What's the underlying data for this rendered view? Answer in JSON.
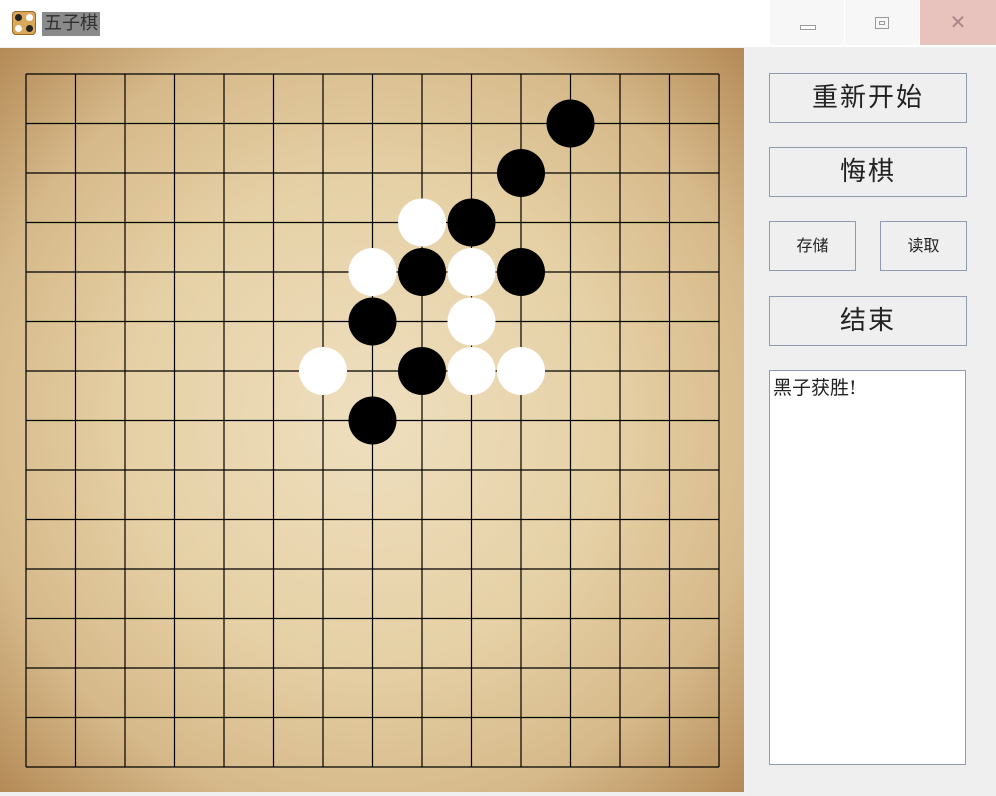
{
  "window": {
    "title": "五子棋",
    "controls": [
      "minimize",
      "maximize",
      "close"
    ]
  },
  "board": {
    "size": 15,
    "stones": [
      {
        "color": "black",
        "col": 11,
        "row": 1
      },
      {
        "color": "black",
        "col": 10,
        "row": 2
      },
      {
        "color": "white",
        "col": 8,
        "row": 3
      },
      {
        "color": "black",
        "col": 9,
        "row": 3
      },
      {
        "color": "white",
        "col": 7,
        "row": 4
      },
      {
        "color": "black",
        "col": 8,
        "row": 4
      },
      {
        "color": "white",
        "col": 9,
        "row": 4
      },
      {
        "color": "black",
        "col": 10,
        "row": 4
      },
      {
        "color": "black",
        "col": 7,
        "row": 5
      },
      {
        "color": "white",
        "col": 9,
        "row": 5
      },
      {
        "color": "white",
        "col": 6,
        "row": 6
      },
      {
        "color": "black",
        "col": 8,
        "row": 6
      },
      {
        "color": "white",
        "col": 9,
        "row": 6
      },
      {
        "color": "white",
        "col": 10,
        "row": 6
      },
      {
        "color": "black",
        "col": 7,
        "row": 7
      }
    ]
  },
  "controls": {
    "restart_label": "重新开始",
    "undo_label": "悔棋",
    "save_label": "存储",
    "load_label": "读取",
    "end_label": "结束"
  },
  "log": {
    "text": "黑子获胜!"
  },
  "colors": {
    "black_stone": "#000000",
    "white_stone": "#ffffff",
    "grid_line": "#000000",
    "button_border": "#8e9bb0"
  }
}
